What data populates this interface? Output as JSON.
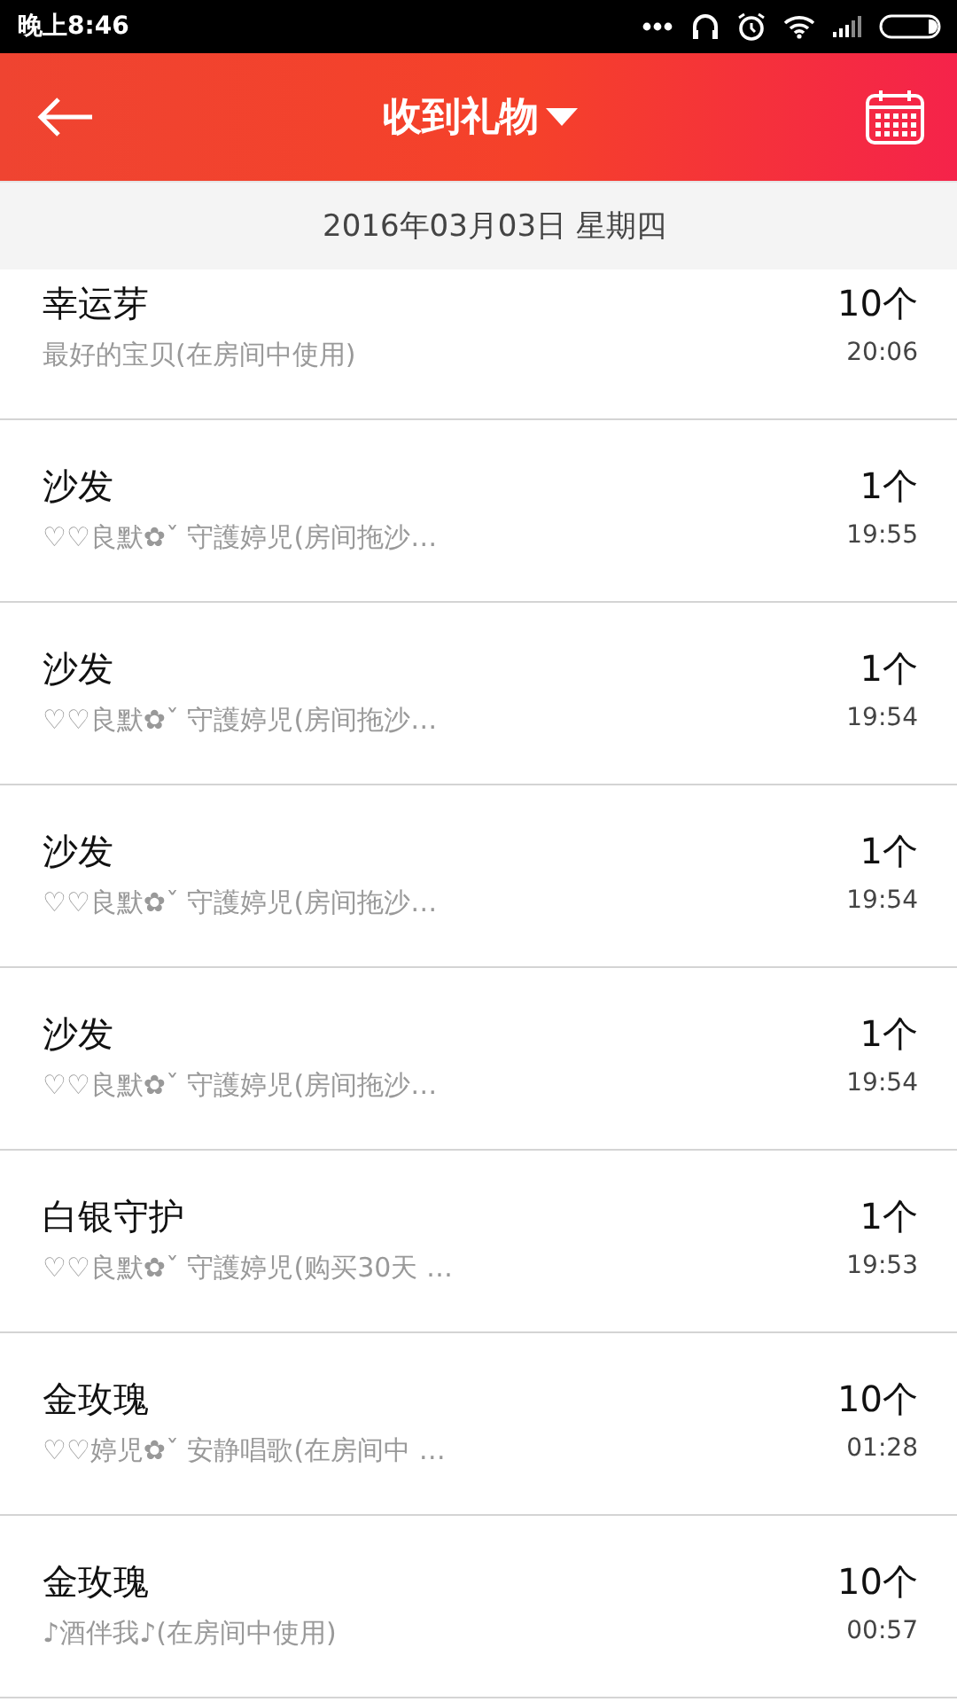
{
  "status_bar": {
    "time": "晚上8:46"
  },
  "header": {
    "title": "收到礼物",
    "has_dropdown": true
  },
  "date_header": "2016年03月03日 星期四",
  "gifts": [
    {
      "name": "幸运芽",
      "detail": "最好的宝贝(在房间中使用)",
      "count": "10个",
      "time": "20:06"
    },
    {
      "name": "沙发",
      "detail": "♡♡良默✿ˇ 守護婷児(房间拖沙…",
      "count": "1个",
      "time": "19:55"
    },
    {
      "name": "沙发",
      "detail": "♡♡良默✿ˇ 守護婷児(房间拖沙…",
      "count": "1个",
      "time": "19:54"
    },
    {
      "name": "沙发",
      "detail": "♡♡良默✿ˇ 守護婷児(房间拖沙…",
      "count": "1个",
      "time": "19:54"
    },
    {
      "name": "沙发",
      "detail": "♡♡良默✿ˇ 守護婷児(房间拖沙…",
      "count": "1个",
      "time": "19:54"
    },
    {
      "name": "白银守护",
      "detail": "♡♡良默✿ˇ 守護婷児(购买30天 …",
      "count": "1个",
      "time": "19:53"
    },
    {
      "name": "金玫瑰",
      "detail": "♡♡婷児✿ˇ 安静唱歌(在房间中 …",
      "count": "10个",
      "time": "01:28"
    },
    {
      "name": "金玫瑰",
      "detail": "♪酒伴我♪(在房间中使用)",
      "count": "10个",
      "time": "00:57"
    }
  ]
}
